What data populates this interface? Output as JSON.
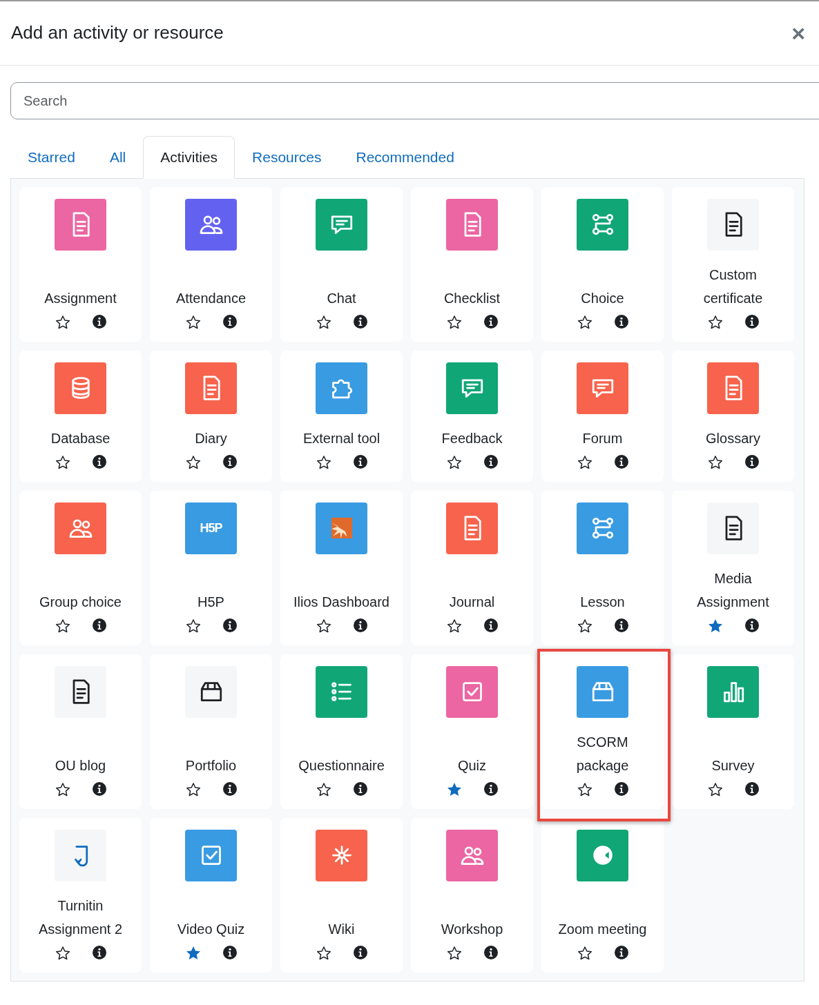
{
  "dialog": {
    "title": "Add an activity or resource",
    "close": "×"
  },
  "search": {
    "placeholder": "Search"
  },
  "tabs": [
    {
      "label": "Starred",
      "selected": false
    },
    {
      "label": "All",
      "selected": false
    },
    {
      "label": "Activities",
      "selected": true
    },
    {
      "label": "Resources",
      "selected": false
    },
    {
      "label": "Recommended",
      "selected": false
    }
  ],
  "items": [
    {
      "name": "Assignment",
      "color": "#eb66a2",
      "starred": false,
      "highlighted": false
    },
    {
      "name": "Attendance",
      "color": "#6362f0",
      "starred": false,
      "highlighted": false
    },
    {
      "name": "Chat",
      "color": "#11a676",
      "starred": false,
      "highlighted": false
    },
    {
      "name": "Checklist",
      "color": "#eb66a2",
      "starred": false,
      "highlighted": false
    },
    {
      "name": "Choice",
      "color": "#11a676",
      "starred": false,
      "highlighted": false
    },
    {
      "name": "Custom certificate",
      "color": "#f5f6f7",
      "starred": false,
      "highlighted": false
    },
    {
      "name": "Database",
      "color": "#f7634d",
      "starred": false,
      "highlighted": false
    },
    {
      "name": "Diary",
      "color": "#f7634d",
      "starred": false,
      "highlighted": false
    },
    {
      "name": "External tool",
      "color": "#399be2",
      "starred": false,
      "highlighted": false
    },
    {
      "name": "Feedback",
      "color": "#11a676",
      "starred": false,
      "highlighted": false
    },
    {
      "name": "Forum",
      "color": "#f7634d",
      "starred": false,
      "highlighted": false
    },
    {
      "name": "Glossary",
      "color": "#f7634d",
      "starred": false,
      "highlighted": false
    },
    {
      "name": "Group choice",
      "color": "#f7634d",
      "starred": false,
      "highlighted": false
    },
    {
      "name": "H5P",
      "color": "#399be2",
      "starred": false,
      "highlighted": false,
      "icon_text": "H5P"
    },
    {
      "name": "Ilios Dashboard",
      "color": "#399be2",
      "starred": false,
      "highlighted": false
    },
    {
      "name": "Journal",
      "color": "#f7634d",
      "starred": false,
      "highlighted": false
    },
    {
      "name": "Lesson",
      "color": "#399be2",
      "starred": false,
      "highlighted": false
    },
    {
      "name": "Media Assignment",
      "color": "#f5f6f7",
      "starred": true,
      "highlighted": false
    },
    {
      "name": "OU blog",
      "color": "#f5f6f7",
      "starred": false,
      "highlighted": false
    },
    {
      "name": "Portfolio",
      "color": "#f5f6f7",
      "starred": false,
      "highlighted": false
    },
    {
      "name": "Questionnaire",
      "color": "#11a676",
      "starred": false,
      "highlighted": false
    },
    {
      "name": "Quiz",
      "color": "#eb66a2",
      "starred": true,
      "highlighted": false
    },
    {
      "name": "SCORM package",
      "color": "#399be2",
      "starred": false,
      "highlighted": true
    },
    {
      "name": "Survey",
      "color": "#11a676",
      "starred": false,
      "highlighted": false
    },
    {
      "name": "Turnitin Assignment 2",
      "color": "#f5f6f7",
      "starred": false,
      "highlighted": false
    },
    {
      "name": "Video Quiz",
      "color": "#399be2",
      "starred": true,
      "highlighted": false
    },
    {
      "name": "Wiki",
      "color": "#f7634d",
      "starred": false,
      "highlighted": false
    },
    {
      "name": "Workshop",
      "color": "#eb66a2",
      "starred": false,
      "highlighted": false
    },
    {
      "name": "Zoom meeting",
      "color": "#11a676",
      "starred": false,
      "highlighted": false
    }
  ]
}
